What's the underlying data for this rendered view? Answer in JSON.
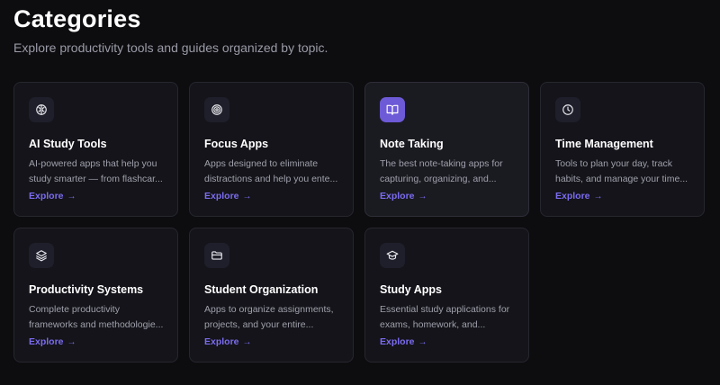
{
  "header": {
    "title": "Categories",
    "subtitle": "Explore productivity tools and guides organized by topic."
  },
  "colors": {
    "background": "#0d0d10",
    "card": "#14141a",
    "accent": "#7b6cf0",
    "active_icon_bg": "#6d5ad6"
  },
  "cards": [
    {
      "title": "AI Study Tools",
      "description": "AI-powered apps that help you study smarter — from flashcar...",
      "link": "Explore",
      "arrow": "→",
      "icon": "brain-icon"
    },
    {
      "title": "Focus Apps",
      "description": "Apps designed to eliminate distractions and help you ente...",
      "link": "Explore",
      "arrow": "→",
      "icon": "target-icon"
    },
    {
      "title": "Note Taking",
      "description": "The best note-taking apps for capturing, organizing, and...",
      "link": "Explore",
      "arrow": "→",
      "icon": "book-open-icon"
    },
    {
      "title": "Time Management",
      "description": "Tools to plan your day, track habits, and manage your time...",
      "link": "Explore",
      "arrow": "→",
      "icon": "clock-icon"
    },
    {
      "title": "Productivity Systems",
      "description": "Complete productivity frameworks and methodologie...",
      "link": "Explore",
      "arrow": "→",
      "icon": "layers-icon"
    },
    {
      "title": "Student Organization",
      "description": "Apps to organize assignments, projects, and your entire...",
      "link": "Explore",
      "arrow": "→",
      "icon": "folder-icon"
    },
    {
      "title": "Study Apps",
      "description": "Essential study applications for exams, homework, and...",
      "link": "Explore",
      "arrow": "→",
      "icon": "graduation-cap-icon"
    }
  ]
}
